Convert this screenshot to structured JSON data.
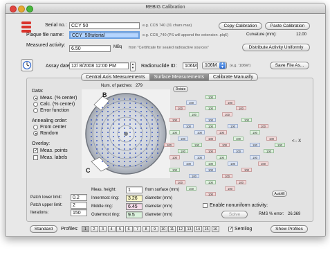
{
  "window": {
    "title": "REBIG Calibration"
  },
  "fields": {
    "serial_label": "Serial no.:",
    "serial_value": "CCY 50",
    "serial_hint": "e.g. CCB 740 (31 chars max)",
    "plaque_label": "Plaque file name:",
    "plaque_value": "CCY_50tutorial",
    "plaque_hint": "e.g. CCB_740 (PS will append the extension .plq6)",
    "activity_label": "Measured activity:",
    "activity_value": "6.50",
    "activity_unit": "MBq",
    "activity_hint": "from \"Certificate for sealed radioactive sources\"",
    "curvature_label": "Curvature (mm):",
    "curvature_value": "12.00",
    "assay_label": "Assay date:",
    "assay_value": "12/ 8/2008 12:00 PM",
    "radionuclide_label": "Radionuclide ID:",
    "radionuclide_value": "106M",
    "radionuclide_popup": "106M",
    "radionuclide_hint": "(e.g. '106M')"
  },
  "buttons": {
    "copy": "Copy Calibration",
    "paste": "Paste Calibration",
    "distribute": "Distribute Activity Uniformly",
    "save": "Save File As...",
    "rotate": "Rotate",
    "autofill": "Autofill",
    "solve": "Solve",
    "standard": "Standard",
    "show_profiles": "Show Profiles"
  },
  "tabs": [
    {
      "label": "Central Axis Measurements",
      "active": false
    },
    {
      "label": "Surface Measurements",
      "active": true
    },
    {
      "label": "Calibrate Manually",
      "active": false
    }
  ],
  "left": {
    "data_label": "Data:",
    "data_options": [
      "Meas. (% center)",
      "Calc. (% center)",
      "Error function"
    ],
    "annealing_label": "Annealing order:",
    "annealing_options": [
      "From center",
      "Random"
    ],
    "overlay_label": "Overlay:",
    "overlay_options": [
      "Meas. points",
      "Meas. labels"
    ],
    "patch_lower_label": "Patch lower limit:",
    "patch_lower_value": "0.2",
    "patch_upper_label": "Patch upper limit:",
    "patch_upper_value": "2",
    "iterations_label": "Iterations:",
    "iterations_value": "150"
  },
  "plaque": {
    "num_patches_label": "Num. of patches:",
    "num_patches_value": "279",
    "mark_b": "B",
    "mark_c": "C"
  },
  "rings": {
    "meas_height_label": "Meas. height:",
    "meas_height_value": "1",
    "meas_height_unit": "from surface (mm)",
    "inner_label": "Innermost ring:",
    "inner_value": "3.26",
    "inner_unit": "diameter (mm)",
    "middle_label": "Middle ring:",
    "middle_value": "6.45",
    "middle_unit": "diameter (mm)",
    "outer_label": "Outermost ring:",
    "outer_value": "9.5",
    "outer_unit": "diameter (mm)"
  },
  "grid": {
    "arrow_label": "<-- X",
    "patches": [
      "100",
      "100",
      "100",
      "100",
      "100",
      "100",
      "100",
      "100",
      "100",
      "100",
      "100",
      "100",
      "100",
      "100",
      "100",
      "100",
      "100",
      "100",
      "100",
      "100",
      "100",
      "100",
      "100",
      "100",
      "100",
      "100",
      "100",
      "100",
      "100",
      "100",
      "100",
      "100",
      "100",
      "100",
      "100",
      "100",
      "100",
      "100",
      "100",
      "100",
      "100",
      "100",
      "100",
      "100",
      "100",
      "100",
      "100",
      "100",
      "100",
      "100",
      "100",
      "100",
      "100",
      "100",
      "100"
    ]
  },
  "nonuniform": {
    "label": "Enable nonuniform activity:",
    "rms_label": "RMS % error:",
    "rms_value": "26.369"
  },
  "bottom": {
    "profiles_label": "Profiles:",
    "profiles": [
      "1",
      "2",
      "3",
      "4",
      "5",
      "6",
      "7",
      "8",
      "9",
      "10",
      "11",
      "12",
      "13",
      "14",
      "15",
      "16"
    ],
    "semilog_label": "Semilog"
  },
  "colors": {
    "accent": "#2f6ed4",
    "logo_red": "#d9332b",
    "selection": "#b5d5ff"
  }
}
